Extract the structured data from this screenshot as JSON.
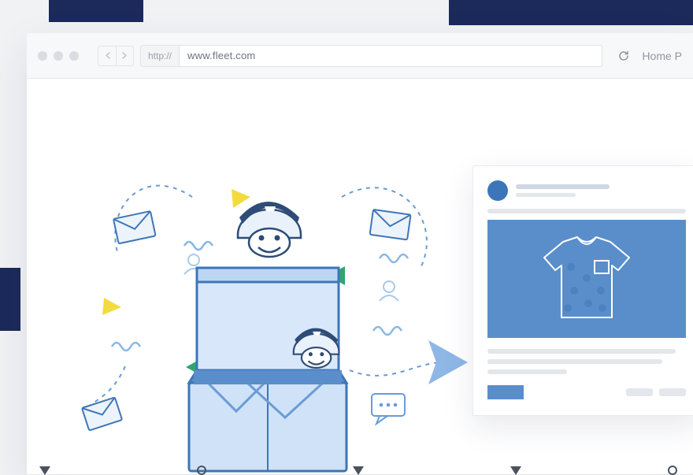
{
  "browser": {
    "scheme": "http://",
    "url": "www.fleet.com",
    "home_label": "Home P"
  }
}
